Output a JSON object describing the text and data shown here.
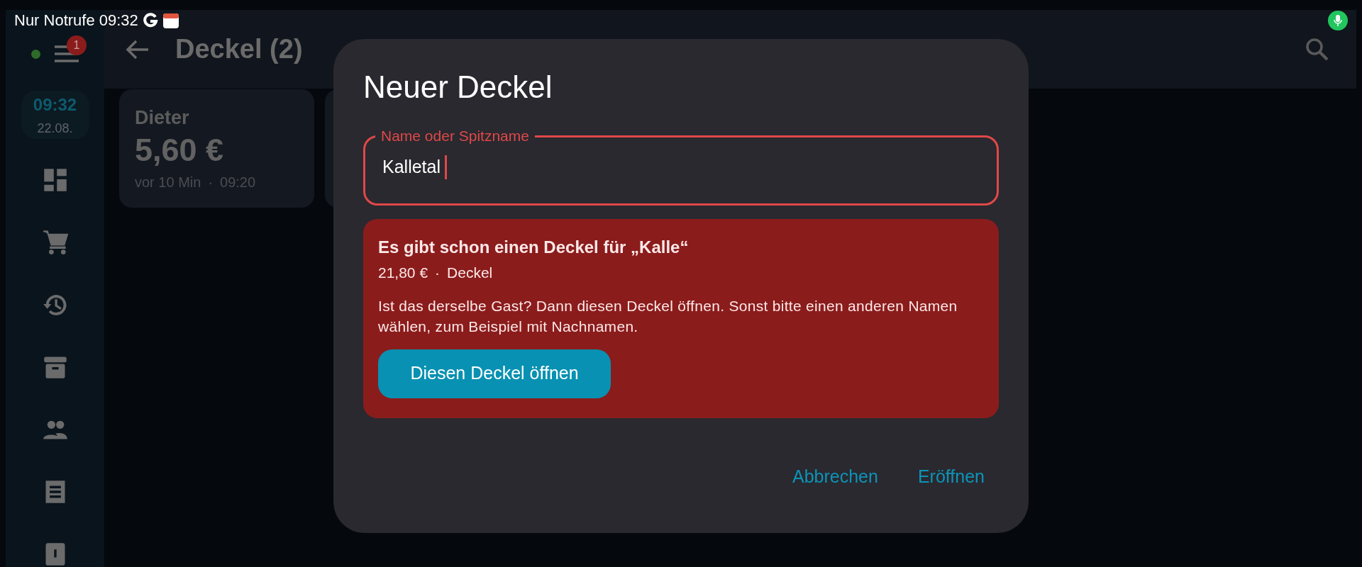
{
  "status_bar": {
    "mode_text": "Nur Notrufe",
    "time": "09:32",
    "mic_active": true
  },
  "sidebar": {
    "online": true,
    "notification_count": "1",
    "clock": {
      "time": "09:32",
      "date": "22.08."
    }
  },
  "header": {
    "title": "Deckel (2)"
  },
  "cards": [
    {
      "name": "Dieter",
      "amount": "5,60 €",
      "age": "vor 10 Min",
      "separator": "·",
      "time": "09:20"
    }
  ],
  "dialog": {
    "title": "Neuer Deckel",
    "field": {
      "label": "Name oder Spitzname",
      "value": "Kalletal",
      "error": true
    },
    "warning": {
      "title": "Es gibt schon einen Deckel für „Kalle“",
      "amount": "21,80 €",
      "separator": "·",
      "type": "Deckel",
      "message": "Ist das derselbe Gast? Dann diesen Deckel öffnen. Sonst bitte einen anderen Namen wählen, zum Beispiel mit Nachnamen.",
      "button": "Diesen Deckel öffnen"
    },
    "actions": [
      "Abbrechen",
      "Eröffnen"
    ]
  }
}
